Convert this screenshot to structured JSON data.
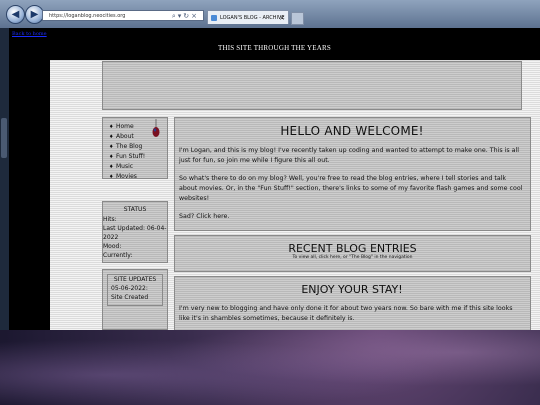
{
  "browser": {
    "address": "https://loganblog.neocities.org",
    "tab_title": "LOGAN'S BLOG - ARCHIVE",
    "tab_close": "×",
    "back": "◀",
    "forward": "▶",
    "addr_icons": "⌕▾↻×"
  },
  "site": {
    "back_link": "Back to home",
    "site_title": "THIS SITE THROUGH THE YEARS"
  },
  "nav": {
    "items": [
      {
        "label": "Home"
      },
      {
        "label": "About"
      },
      {
        "label": "The Blog"
      },
      {
        "label": "Fun Stuff!"
      },
      {
        "label": "Music"
      },
      {
        "label": "Movies"
      }
    ]
  },
  "status": {
    "title": "STATUS",
    "lines": [
      "Hits:",
      "Last Updated: 06-04-2022",
      "Mood:",
      "Currently:"
    ]
  },
  "updates": {
    "title": "SITE UPDATES",
    "entry": "05-06-2022: Site Created"
  },
  "welcome": {
    "heading": "HELLO AND WELCOME!",
    "p1": "I'm Logan, and this is my blog! I've recently taken up coding and wanted to attempt to make one. This is all just for fun, so join me while I figure this all out.",
    "p2": "So what's there to do on my blog? Well, you're free to read the blog entries, where I tell stories and talk about movies. Or, in the \"Fun Stuff!\" section, there's links to some of my favorite flash games and some cool websites!",
    "p3": "Sad? Click here."
  },
  "recent": {
    "heading": "RECENT BLOG ENTRIES",
    "sub": "To view all, click here, or \"The Blog\" in the navigation"
  },
  "enjoy": {
    "heading": "ENJOY YOUR STAY!",
    "p1": "I'm very new to blogging and have only done it for about two years now. So bare with me if this site looks like it's in shambles sometimes, because it definitely is."
  }
}
